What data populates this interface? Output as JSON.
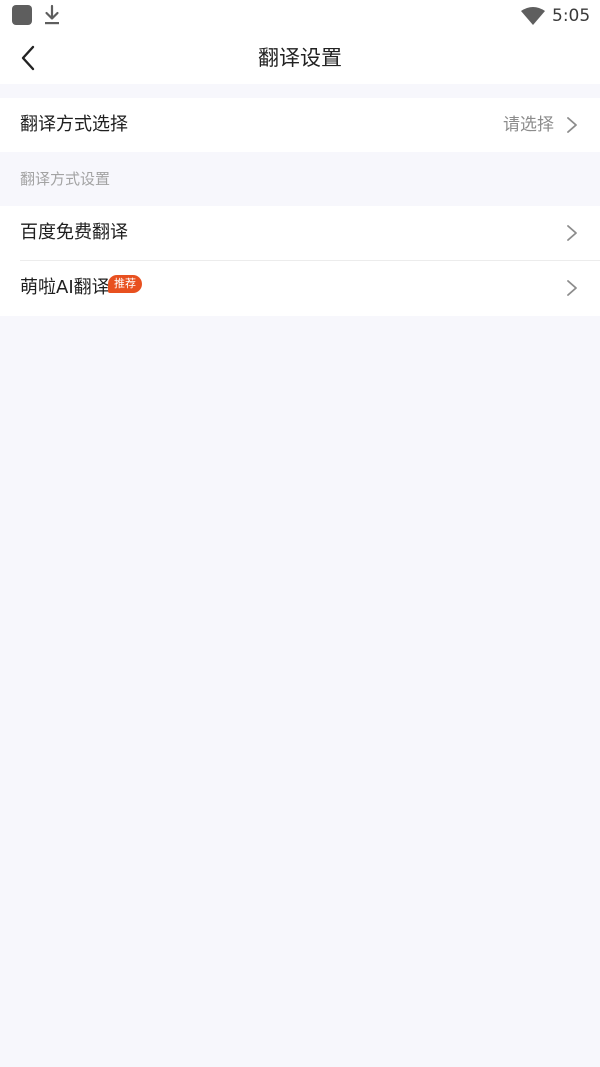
{
  "status_bar": {
    "time": "5:05",
    "icons": [
      "app-icon",
      "download-icon",
      "wifi-icon"
    ]
  },
  "nav": {
    "title": "翻译设置",
    "back_icon": "chevron-left-icon"
  },
  "mode_select": {
    "label": "翻译方式选择",
    "value": "请选择"
  },
  "section": {
    "header": "翻译方式设置"
  },
  "services": [
    {
      "label": "百度免费翻译"
    },
    {
      "label": "萌啦AI翻译",
      "badge": "推荐"
    }
  ],
  "colors": {
    "background": "#f7f7fc",
    "badge": "#e8501f",
    "secondary_text": "#8c8c8c"
  }
}
